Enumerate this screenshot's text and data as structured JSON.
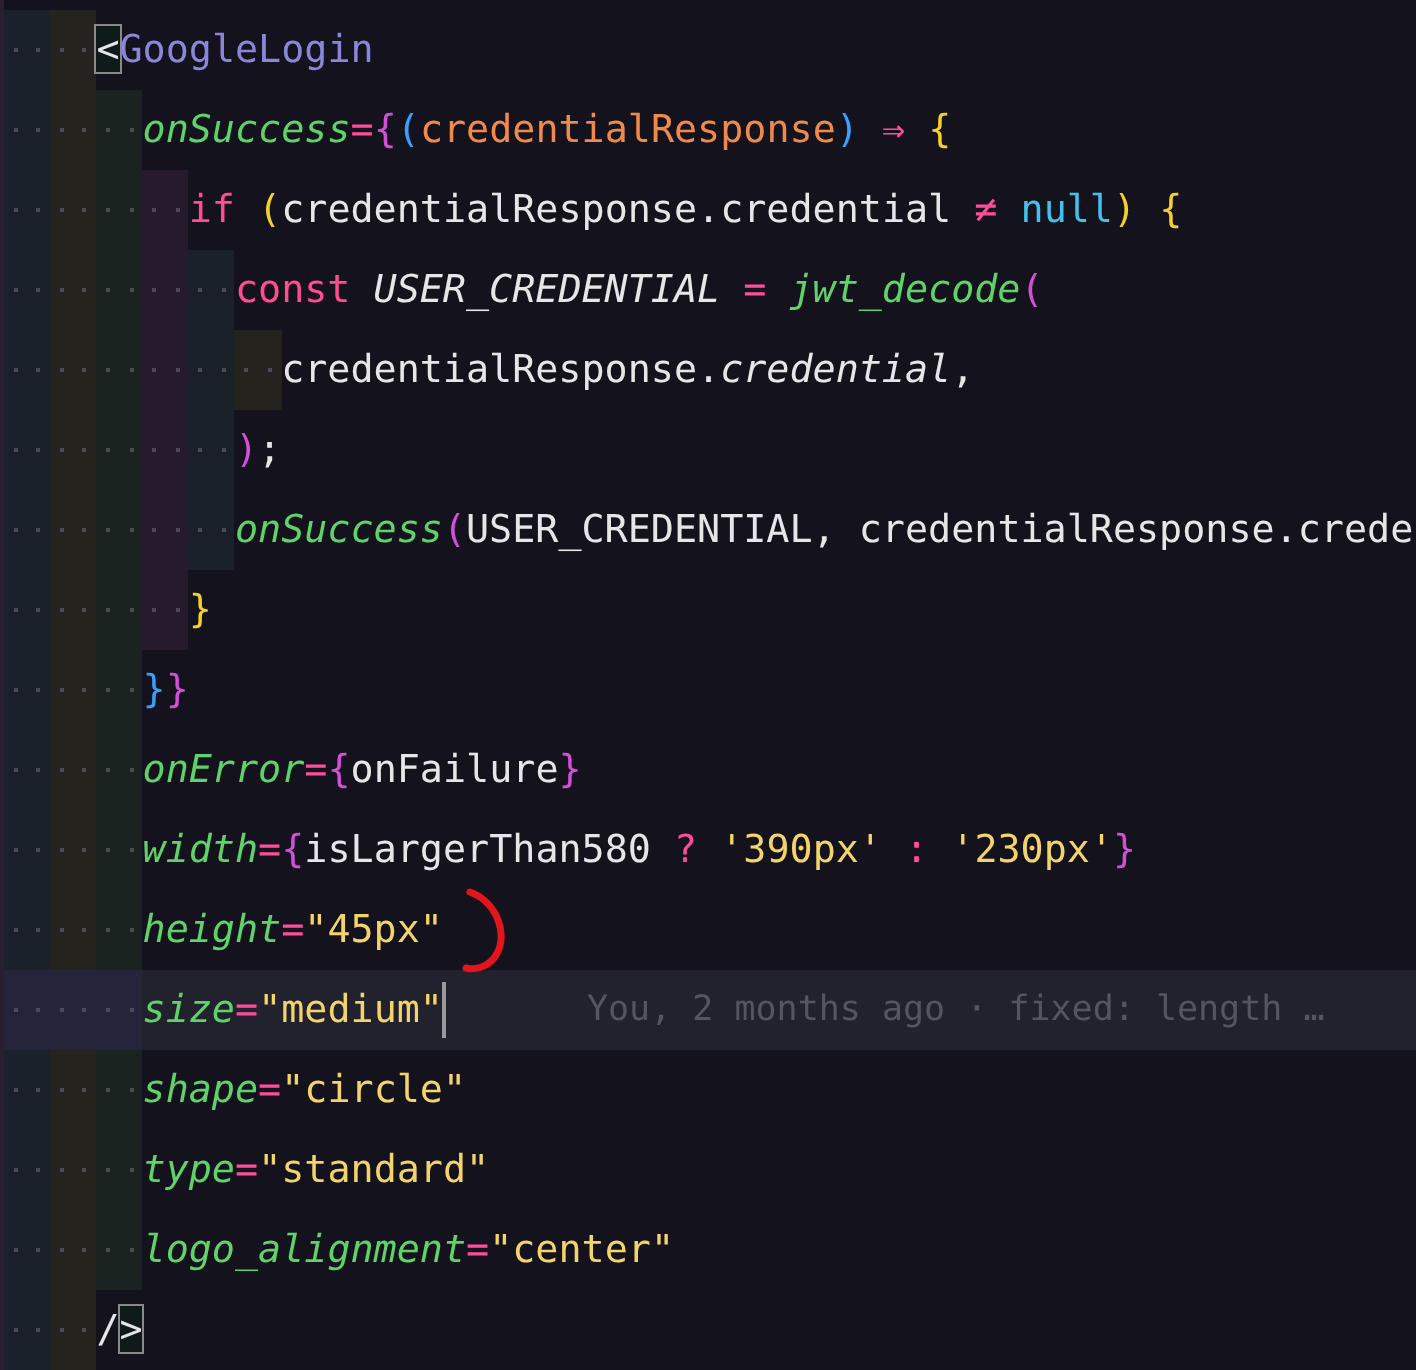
{
  "lines": [
    {
      "current": false,
      "tokens": [
        {
          "kind": "match",
          "text": "<"
        },
        {
          "kind": "tag",
          "text": "GoogleLogin"
        }
      ],
      "children": [
        {
          "current": false,
          "tokens": [
            {
              "kind": "attr",
              "text": "onSuccess"
            },
            {
              "kind": "op",
              "text": "="
            },
            {
              "kind": "b1",
              "text": "{"
            },
            {
              "kind": "b2",
              "text": "("
            },
            {
              "kind": "param",
              "text": "credentialResponse"
            },
            {
              "kind": "b2",
              "text": ")"
            },
            {
              "kind": "op",
              "text": " ⇒ "
            },
            {
              "kind": "b3",
              "text": "{"
            }
          ],
          "children": [
            {
              "current": false,
              "tokens": [
                {
                  "kind": "keyword",
                  "text": "if "
                },
                {
                  "kind": "b3",
                  "text": "("
                },
                {
                  "kind": "plain",
                  "text": "credentialResponse.credential "
                },
                {
                  "kind": "op",
                  "text": "≠ "
                },
                {
                  "kind": "const",
                  "text": "null"
                },
                {
                  "kind": "b3",
                  "text": ")"
                },
                {
                  "kind": "b3",
                  "text": " {"
                }
              ],
              "children": [
                {
                  "current": false,
                  "tokens": [
                    {
                      "kind": "keyword",
                      "text": "const "
                    },
                    {
                      "kind": "italic",
                      "text": "USER_CREDENTIAL"
                    },
                    {
                      "kind": "op",
                      "text": " = "
                    },
                    {
                      "kind": "func",
                      "text": "jwt_decode"
                    },
                    {
                      "kind": "b1",
                      "text": "("
                    }
                  ],
                  "children": [
                    {
                      "current": false,
                      "tokens": [
                        {
                          "kind": "plain",
                          "text": "credentialResponse."
                        },
                        {
                          "kind": "italic",
                          "text": "credential"
                        },
                        {
                          "kind": "plain",
                          "text": ","
                        }
                      ]
                    }
                  ]
                },
                {
                  "current": false,
                  "tokens": [
                    {
                      "kind": "b1",
                      "text": ")"
                    },
                    {
                      "kind": "plain",
                      "text": ";"
                    }
                  ]
                },
                {
                  "current": false,
                  "tokens": [
                    {
                      "kind": "func",
                      "text": "onSuccess"
                    },
                    {
                      "kind": "b1",
                      "text": "("
                    },
                    {
                      "kind": "plain",
                      "text": "USER_CREDENTIAL, credentialResponse.crede"
                    }
                  ]
                }
              ]
            },
            {
              "current": false,
              "tokens": [
                {
                  "kind": "b3",
                  "text": "}"
                }
              ]
            }
          ]
        },
        {
          "current": false,
          "tokens": [
            {
              "kind": "b2",
              "text": "}"
            },
            {
              "kind": "b1",
              "text": "}"
            }
          ]
        },
        {
          "current": false,
          "tokens": [
            {
              "kind": "attr",
              "text": "onError"
            },
            {
              "kind": "op",
              "text": "="
            },
            {
              "kind": "b1",
              "text": "{"
            },
            {
              "kind": "plain",
              "text": "onFailure"
            },
            {
              "kind": "b1",
              "text": "}"
            }
          ]
        },
        {
          "current": false,
          "tokens": [
            {
              "kind": "attr",
              "text": "width"
            },
            {
              "kind": "op",
              "text": "="
            },
            {
              "kind": "b1",
              "text": "{"
            },
            {
              "kind": "plain",
              "text": "isLargerThan580 "
            },
            {
              "kind": "op",
              "text": "? "
            },
            {
              "kind": "string",
              "text": "'390px'"
            },
            {
              "kind": "op",
              "text": " : "
            },
            {
              "kind": "string",
              "text": "'230px'"
            },
            {
              "kind": "b1",
              "text": "}"
            }
          ]
        },
        {
          "current": false,
          "tokens": [
            {
              "kind": "attr",
              "text": "height"
            },
            {
              "kind": "op",
              "text": "="
            },
            {
              "kind": "string",
              "text": "\"45px\""
            }
          ]
        },
        {
          "current": true,
          "blame": "You, 2 months ago · fixed: length …",
          "tokens": [
            {
              "kind": "attr",
              "text": "size"
            },
            {
              "kind": "op",
              "text": "="
            },
            {
              "kind": "string",
              "text": "\"medium\""
            }
          ]
        },
        {
          "current": false,
          "tokens": [
            {
              "kind": "attr",
              "text": "shape"
            },
            {
              "kind": "op",
              "text": "="
            },
            {
              "kind": "string",
              "text": "\"circle\""
            }
          ]
        },
        {
          "current": false,
          "tokens": [
            {
              "kind": "attr",
              "text": "type"
            },
            {
              "kind": "op",
              "text": "="
            },
            {
              "kind": "string",
              "text": "\"standard\""
            }
          ]
        },
        {
          "current": false,
          "tokens": [
            {
              "kind": "attr",
              "text": "logo_alignment"
            },
            {
              "kind": "op",
              "text": "="
            },
            {
              "kind": "string",
              "text": "\"center\""
            }
          ]
        }
      ]
    },
    {
      "current": false,
      "tokens": [
        {
          "kind": "plain",
          "text": "/"
        },
        {
          "kind": "match",
          "text": ">"
        }
      ]
    }
  ]
}
